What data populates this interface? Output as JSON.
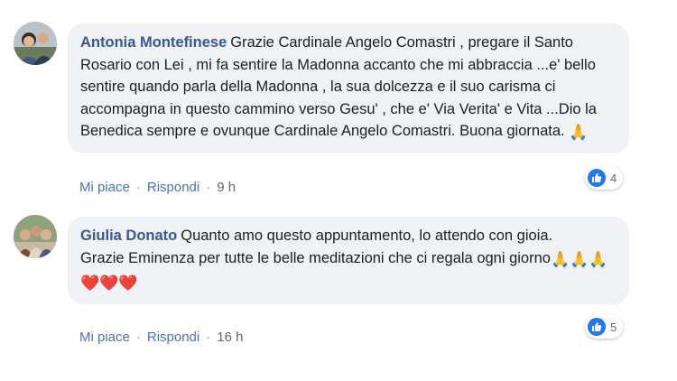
{
  "comments": [
    {
      "author": "Antonia Montefinese",
      "text": "Grazie Cardinale Angelo Comastri , pregare il Santo Rosario con Lei , mi fa sentire la Madonna accanto che mi abbraccia ...e' bello sentire quando parla della Madonna , la sua dolcezza e il suo carisma ci accompagna in questo cammino verso Gesu' , che e' Via Verita' e Vita ...Dio la Benedica sempre e ovunque Cardinale Angelo Comastri. Buona giornata.",
      "emoji": "🙏",
      "like_label": "Mi piace",
      "reply_label": "Rispondi",
      "time": "9 h",
      "reaction_icon": "like-icon",
      "reaction_count": "4"
    },
    {
      "author": "Giulia Donato",
      "text": "Quanto amo questo appuntamento, lo attendo con gioia.\nGrazie Eminenza per tutte le belle meditazioni che ci regala ogni giorno",
      "emoji": "🙏🙏🙏❤️❤️❤️",
      "like_label": "Mi piace",
      "reply_label": "Rispondi",
      "time": "16 h",
      "reaction_icon": "like-icon",
      "reaction_count": "5"
    }
  ],
  "colors": {
    "author": "#385898",
    "bubble": "#f0f2f5",
    "like_blue": "#2078f4",
    "action_link": "#4b73b8"
  }
}
